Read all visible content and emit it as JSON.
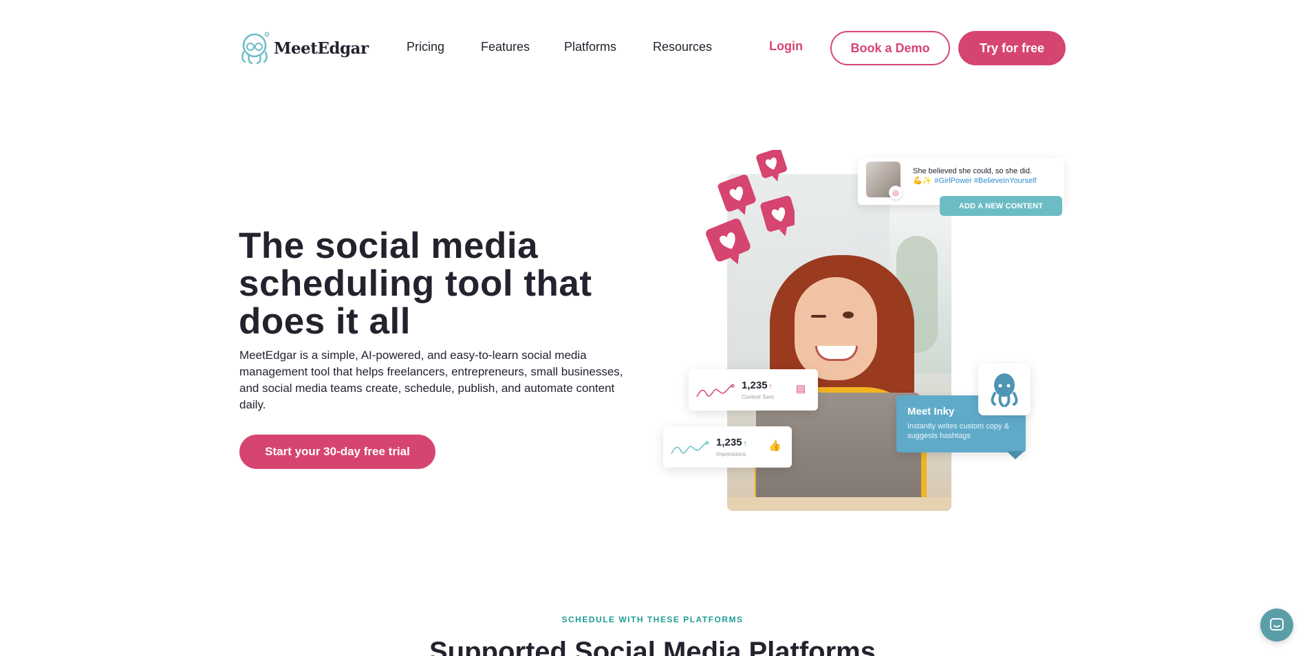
{
  "brand": {
    "name": "MeetEdgar",
    "accent": "#d6456f",
    "teal": "#1f9e94"
  },
  "nav": {
    "links": [
      "Pricing",
      "Features",
      "Platforms",
      "Resources"
    ],
    "login": "Login",
    "book_demo": "Book a Demo",
    "try_free": "Try for free"
  },
  "hero": {
    "title": "The social media scheduling tool that does it all",
    "description": "MeetEdgar is a simple, AI-powered, and easy-to-learn social media management tool that helps freelancers, entrepreneurs, small businesses, and social media teams create, schedule, publish, and automate content daily.",
    "cta": "Start your 30-day free trial"
  },
  "illustration": {
    "post_text": "She believed she could, so she did.",
    "post_emoji": "💪✨",
    "post_tags": "#GirlPower #BelieveInYourself",
    "add_content": "ADD A NEW CONTENT",
    "stat_content_sent": {
      "value": "1,235",
      "arrow": "↑",
      "label": "Content Sent",
      "icon": "document-icon"
    },
    "stat_impressions": {
      "value": "1,235",
      "arrow": "↑",
      "label": "Impressions",
      "icon": "thumbs-up-icon"
    },
    "inky_title": "Meet Inky",
    "inky_desc": "Instantly writes custom copy & suggests hashtags"
  },
  "platforms": {
    "eyebrow": "SCHEDULE WITH THESE PLATFORMS",
    "title": "Supported Social Media Platforms"
  }
}
